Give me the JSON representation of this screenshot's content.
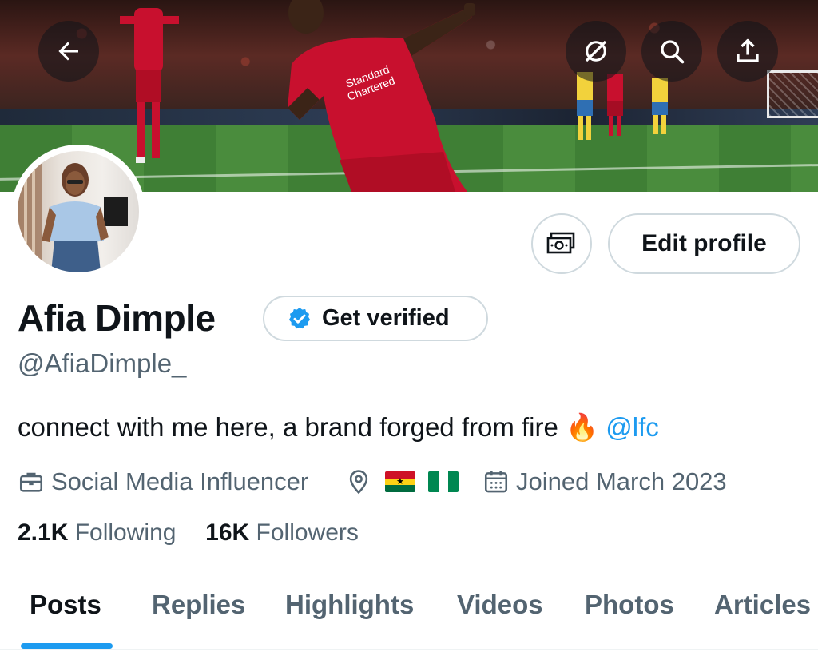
{
  "header": {
    "back_icon": "arrow-left-icon",
    "grok_icon": "grok-icon",
    "search_icon": "search-icon",
    "share_icon": "share-icon"
  },
  "profile": {
    "display_name": "Afia Dimple",
    "get_verified_label": "Get verified",
    "handle": "@AfiaDimple_",
    "bio_text": "connect with me here, a brand forged from fire ",
    "bio_emoji": "🔥",
    "bio_mention": "@lfc",
    "occupation": "Social Media Influencer",
    "joined": "Joined March 2023",
    "edit_profile_label": "Edit profile",
    "following_count": "2.1K",
    "following_label": "Following",
    "followers_count": "16K",
    "followers_label": "Followers"
  },
  "tabs": [
    {
      "label": "Posts",
      "active": true
    },
    {
      "label": "Replies",
      "active": false
    },
    {
      "label": "Highlights",
      "active": false
    },
    {
      "label": "Videos",
      "active": false
    },
    {
      "label": "Photos",
      "active": false
    },
    {
      "label": "Articles",
      "active": false
    }
  ],
  "colors": {
    "accent": "#1d9bf0",
    "text": "#0f1419",
    "secondary_text": "#536471",
    "border": "#cfd9de"
  }
}
